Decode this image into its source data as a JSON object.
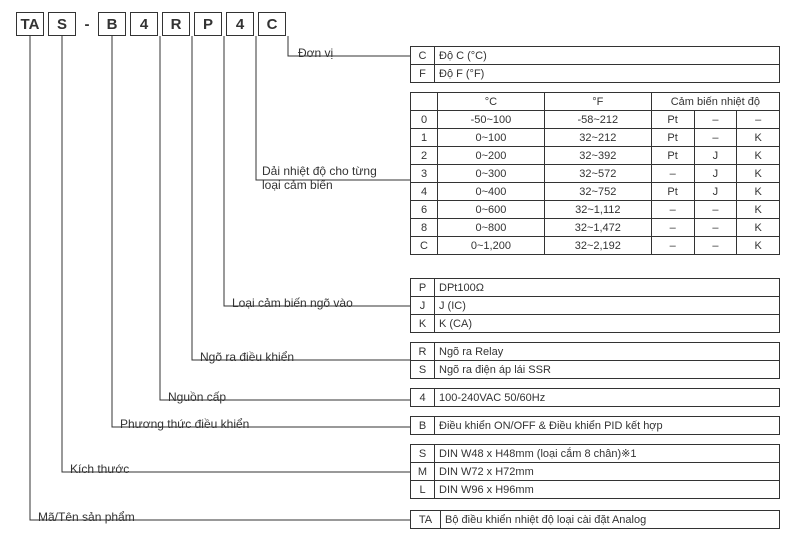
{
  "code": [
    "TA",
    "S",
    "-",
    "B",
    "4",
    "R",
    "P",
    "4",
    "C"
  ],
  "labels": {
    "unit": "Đơn vị",
    "temp_range": "Dải nhiệt độ cho từng loại cảm biến",
    "sensor_in": "Loại cảm biến ngõ vào",
    "ctrl_out": "Ngõ ra điều khiển",
    "power": "Nguồn cấp",
    "ctrl_method": "Phương thức điều khiển",
    "size": "Kích thước",
    "product": "Mã/Tên sản phẩm"
  },
  "unit_table": {
    "rows": [
      {
        "k": "C",
        "v": "Độ C (°C)"
      },
      {
        "k": "F",
        "v": "Độ F (°F)"
      }
    ]
  },
  "temp_table": {
    "header": {
      "c": "",
      "degc": "°C",
      "degf": "°F",
      "sensor": "Cảm biến nhiệt độ"
    },
    "rows": [
      {
        "c": "0",
        "degc": "-50~100",
        "degf": "-58~212",
        "s1": "Pt",
        "s2": "–",
        "s3": "–"
      },
      {
        "c": "1",
        "degc": "0~100",
        "degf": "32~212",
        "s1": "Pt",
        "s2": "–",
        "s3": "K"
      },
      {
        "c": "2",
        "degc": "0~200",
        "degf": "32~392",
        "s1": "Pt",
        "s2": "J",
        "s3": "K"
      },
      {
        "c": "3",
        "degc": "0~300",
        "degf": "32~572",
        "s1": "–",
        "s2": "J",
        "s3": "K"
      },
      {
        "c": "4",
        "degc": "0~400",
        "degf": "32~752",
        "s1": "Pt",
        "s2": "J",
        "s3": "K"
      },
      {
        "c": "6",
        "degc": "0~600",
        "degf": "32~1,112",
        "s1": "–",
        "s2": "–",
        "s3": "K"
      },
      {
        "c": "8",
        "degc": "0~800",
        "degf": "32~1,472",
        "s1": "–",
        "s2": "–",
        "s3": "K"
      },
      {
        "c": "C",
        "degc": "0~1,200",
        "degf": "32~2,192",
        "s1": "–",
        "s2": "–",
        "s3": "K"
      }
    ]
  },
  "sensor_in_table": {
    "rows": [
      {
        "k": "P",
        "v": "DPt100Ω"
      },
      {
        "k": "J",
        "v": "J (IC)"
      },
      {
        "k": "K",
        "v": "K (CA)"
      }
    ]
  },
  "ctrl_out_table": {
    "rows": [
      {
        "k": "R",
        "v": "Ngõ ra Relay"
      },
      {
        "k": "S",
        "v": "Ngõ ra điện áp lái SSR"
      }
    ]
  },
  "power_table": {
    "rows": [
      {
        "k": "4",
        "v": "100-240VAC 50/60Hz"
      }
    ]
  },
  "ctrl_method_table": {
    "rows": [
      {
        "k": "B",
        "v": "Điều khiển ON/OFF & Điều khiển PID kết hợp"
      }
    ]
  },
  "size_table": {
    "rows": [
      {
        "k": "S",
        "v": "DIN W48 x H48mm (loại cắm 8 chân)※1"
      },
      {
        "k": "M",
        "v": "DIN W72 x H72mm"
      },
      {
        "k": "L",
        "v": "DIN W96 x H96mm"
      }
    ]
  },
  "product_table": {
    "rows": [
      {
        "k": "TA",
        "v": "Bộ điều khiển nhiệt độ loại cài đặt Analog"
      }
    ]
  }
}
